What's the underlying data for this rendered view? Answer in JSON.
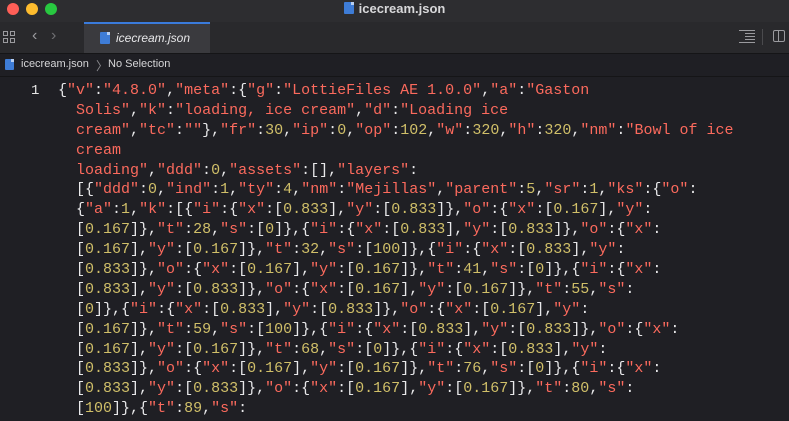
{
  "window": {
    "title": "icecream.json"
  },
  "tabbar": {
    "tab_label": "icecream.json"
  },
  "jumpbar": {
    "file": "icecream.json",
    "separator": "〉",
    "selection": "No Selection"
  },
  "editor": {
    "line_number": "1",
    "code_lines": [
      "{\"v\":\"4.8.0\",\"meta\":{\"g\":\"LottieFiles AE 1.0.0\",\"a\":\"Gaston",
      "  Solis\",\"k\":\"loading, ice cream\",\"d\":\"Loading ice",
      "  cream\",\"tc\":\"\"},\"fr\":30,\"ip\":0,\"op\":102,\"w\":320,\"h\":320,\"nm\":\"Bowl of ice",
      "  cream",
      "  loading\",\"ddd\":0,\"assets\":[],\"layers\":",
      "  [{\"ddd\":0,\"ind\":1,\"ty\":4,\"nm\":\"Mejillas\",\"parent\":5,\"sr\":1,\"ks\":{\"o\":",
      "  {\"a\":1,\"k\":[{\"i\":{\"x\":[0.833],\"y\":[0.833]},\"o\":{\"x\":[0.167],\"y\":",
      "  [0.167]},\"t\":28,\"s\":[0]},{\"i\":{\"x\":[0.833],\"y\":[0.833]},\"o\":{\"x\":",
      "  [0.167],\"y\":[0.167]},\"t\":32,\"s\":[100]},{\"i\":{\"x\":[0.833],\"y\":",
      "  [0.833]},\"o\":{\"x\":[0.167],\"y\":[0.167]},\"t\":41,\"s\":[0]},{\"i\":{\"x\":",
      "  [0.833],\"y\":[0.833]},\"o\":{\"x\":[0.167],\"y\":[0.167]},\"t\":55,\"s\":",
      "  [0]},{\"i\":{\"x\":[0.833],\"y\":[0.833]},\"o\":{\"x\":[0.167],\"y\":",
      "  [0.167]},\"t\":59,\"s\":[100]},{\"i\":{\"x\":[0.833],\"y\":[0.833]},\"o\":{\"x\":",
      "  [0.167],\"y\":[0.167]},\"t\":68,\"s\":[0]},{\"i\":{\"x\":[0.833],\"y\":",
      "  [0.833]},\"o\":{\"x\":[0.167],\"y\":[0.167]},\"t\":76,\"s\":[0]},{\"i\":{\"x\":",
      "  [0.833],\"y\":[0.833]},\"o\":{\"x\":[0.167],\"y\":[0.167]},\"t\":80,\"s\":",
      "  [100]},{\"t\":89,\"s\":"
    ]
  },
  "colors": {
    "string": "#fc6a5d",
    "number": "#d0bf69",
    "punctuation": "#e8e8ea",
    "accent": "#3a7bdc"
  },
  "icons": [
    "close-window-icon",
    "minimize-window-icon",
    "zoom-window-icon",
    "json-file-icon",
    "grid-icon",
    "chevron-left-icon",
    "chevron-right-icon",
    "minimap-icon",
    "split-editor-icon"
  ]
}
